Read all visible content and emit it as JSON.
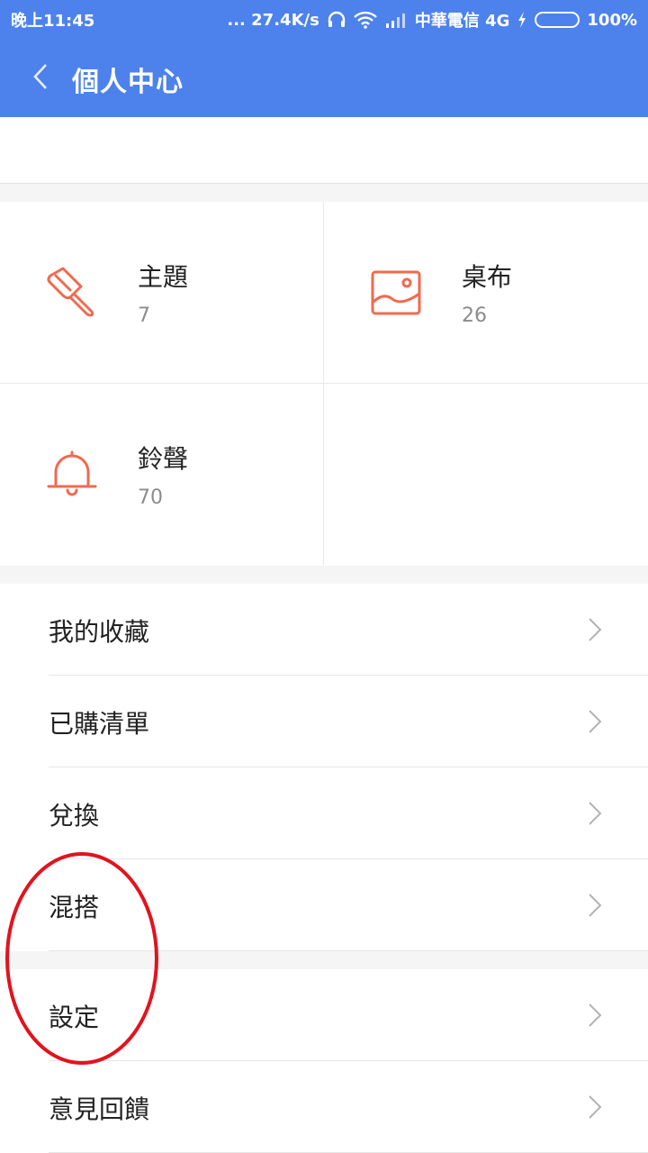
{
  "status_bar": {
    "time": "晚上11:45",
    "net_speed": "... 27.4K/s",
    "carrier": "中華電信 4G",
    "battery": "100%"
  },
  "app_bar": {
    "title": "個人中心",
    "back_icon": "chevron-left-icon"
  },
  "grid": [
    {
      "label": "主題",
      "count": "7",
      "icon": "paintbrush-icon"
    },
    {
      "label": "桌布",
      "count": "26",
      "icon": "image-icon"
    },
    {
      "label": "鈴聲",
      "count": "70",
      "icon": "bell-icon"
    }
  ],
  "list_group1": [
    {
      "label": "我的收藏"
    },
    {
      "label": "已購清單"
    },
    {
      "label": "兌換"
    },
    {
      "label": "混搭"
    }
  ],
  "list_group2": [
    {
      "label": "設定"
    },
    {
      "label": "意見回饋"
    }
  ],
  "colors": {
    "accent": "#4d82ec",
    "icon": "#f06a4f",
    "annotation": "#e0141e",
    "battery": "#4ec429"
  }
}
